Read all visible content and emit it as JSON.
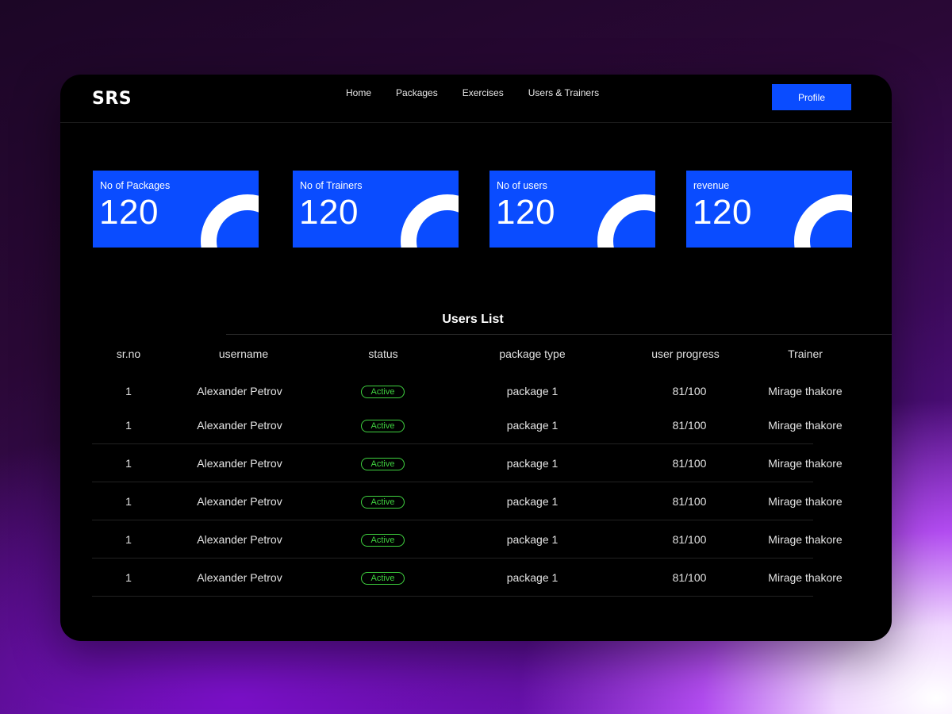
{
  "app": {
    "logo": "SRS"
  },
  "nav": {
    "links": [
      "Home",
      "Packages",
      "Exercises",
      "Users & Trainers"
    ],
    "profile_label": "Profile"
  },
  "stats": [
    {
      "label": "No of Packages",
      "value": "120"
    },
    {
      "label": "No of Trainers",
      "value": "120"
    },
    {
      "label": "No of users",
      "value": "120"
    },
    {
      "label": "revenue",
      "value": "120"
    }
  ],
  "users_list": {
    "title": "Users List",
    "columns": [
      "sr.no",
      "username",
      "status",
      "package type",
      "user progress",
      "Trainer"
    ],
    "rows": [
      {
        "srno": "1",
        "username": "Alexander Petrov",
        "status": "Active",
        "package": "package 1",
        "progress": "81/100",
        "trainer": "Mirage thakore"
      },
      {
        "srno": "1",
        "username": "Alexander Petrov",
        "status": "Active",
        "package": "package 1",
        "progress": "81/100",
        "trainer": "Mirage thakore"
      },
      {
        "srno": "1",
        "username": "Alexander Petrov",
        "status": "Active",
        "package": "package 1",
        "progress": "81/100",
        "trainer": "Mirage thakore"
      },
      {
        "srno": "1",
        "username": "Alexander Petrov",
        "status": "Active",
        "package": "package 1",
        "progress": "81/100",
        "trainer": "Mirage thakore"
      },
      {
        "srno": "1",
        "username": "Alexander Petrov",
        "status": "Active",
        "package": "package 1",
        "progress": "81/100",
        "trainer": "Mirage thakore"
      },
      {
        "srno": "1",
        "username": "Alexander Petrov",
        "status": "Active",
        "package": "package 1",
        "progress": "81/100",
        "trainer": "Mirage thakore"
      }
    ]
  },
  "colors": {
    "accent": "#0a4cff",
    "status_active": "#3fd13f",
    "panel": "#000000"
  }
}
